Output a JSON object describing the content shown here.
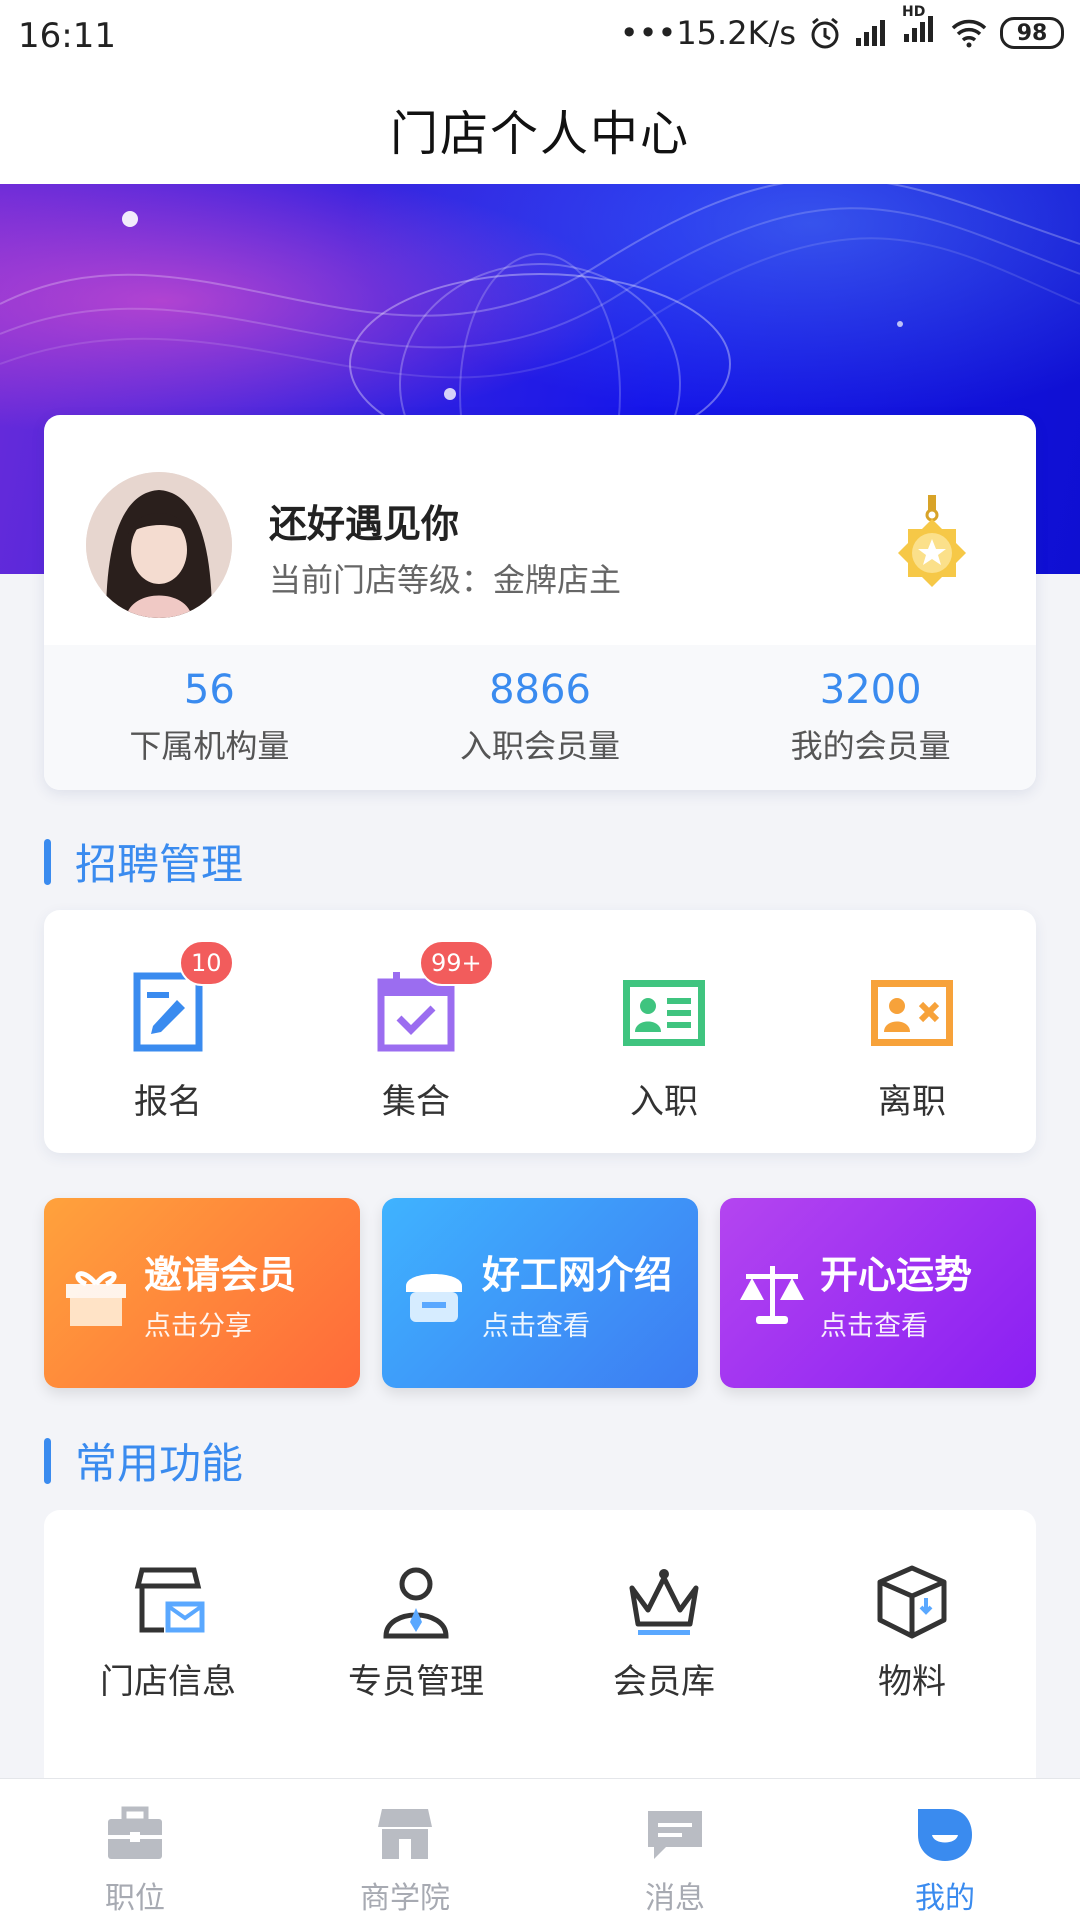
{
  "status_bar": {
    "time": "16:11",
    "network_speed": "•••15.2K/s",
    "battery": "98",
    "signal_label": "HD"
  },
  "header": {
    "title": "门店个人中心"
  },
  "profile": {
    "name": "还好遇见你",
    "level_text": "当前门店等级：金牌店主",
    "stats": [
      {
        "value": "56",
        "label": "下属机构量"
      },
      {
        "value": "8866",
        "label": "入职会员量"
      },
      {
        "value": "3200",
        "label": "我的会员量"
      }
    ]
  },
  "recruit": {
    "section_title": "招聘管理",
    "items": [
      {
        "label": "报名",
        "badge": "10",
        "icon": "signup-form-icon",
        "color": "#3a8bef"
      },
      {
        "label": "集合",
        "badge": "99+",
        "icon": "calendar-check-icon",
        "color": "#9b6df0"
      },
      {
        "label": "入职",
        "badge": "",
        "icon": "id-card-icon",
        "color": "#3fc47f"
      },
      {
        "label": "离职",
        "badge": "",
        "icon": "id-card-remove-icon",
        "color": "#f7a23a"
      }
    ]
  },
  "promos": [
    {
      "title": "邀请会员",
      "subtitle": "点击分享",
      "icon": "gift-icon"
    },
    {
      "title": "好工网介绍",
      "subtitle": "点击查看",
      "icon": "store-icon"
    },
    {
      "title": "开心运势",
      "subtitle": "点击查看",
      "icon": "scale-icon"
    }
  ],
  "common": {
    "section_title": "常用功能",
    "items": [
      {
        "label": "门店信息",
        "icon": "store-mail-icon"
      },
      {
        "label": "专员管理",
        "icon": "person-tie-icon"
      },
      {
        "label": "会员库",
        "icon": "crown-icon"
      },
      {
        "label": "物料",
        "icon": "box-icon"
      }
    ]
  },
  "tabs": [
    {
      "label": "职位",
      "icon": "briefcase-icon",
      "active": false
    },
    {
      "label": "商学院",
      "icon": "store-icon",
      "active": false
    },
    {
      "label": "消息",
      "icon": "message-icon",
      "active": false
    },
    {
      "label": "我的",
      "icon": "profile-icon",
      "active": true
    }
  ],
  "colors": {
    "accent": "#3a8bef",
    "badge": "#f25c5c",
    "tab_inactive": "#a7aab2"
  }
}
